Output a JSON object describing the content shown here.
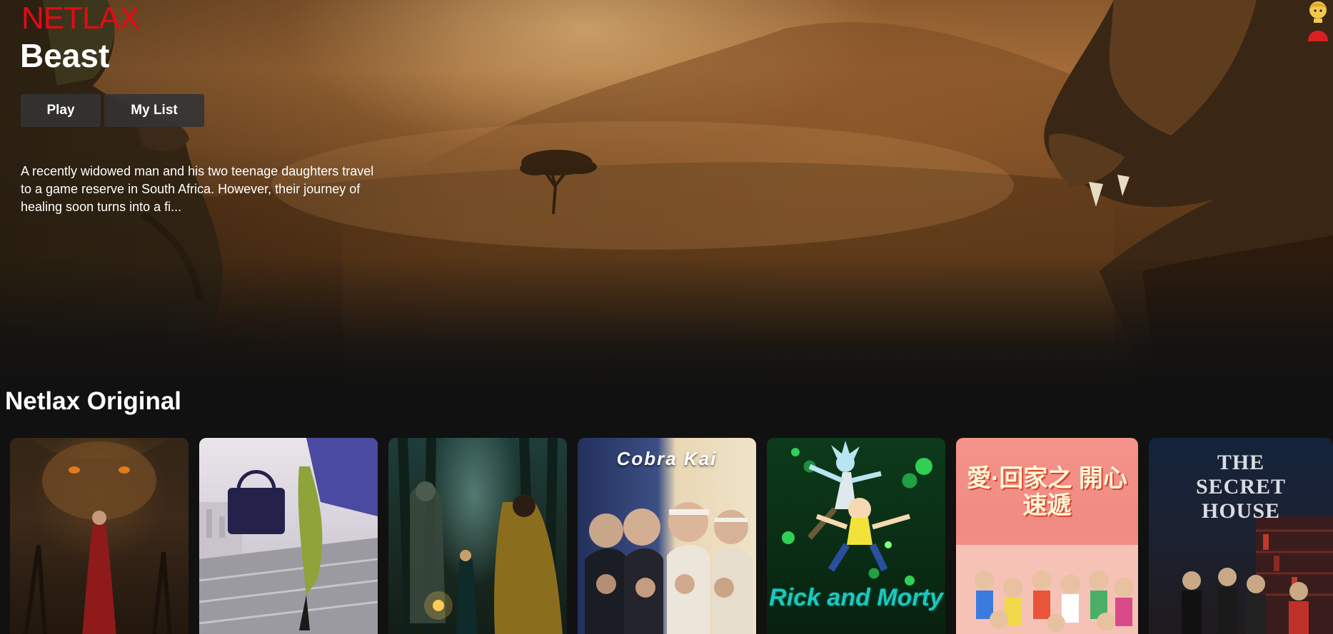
{
  "header": {
    "logo": "NETLAX",
    "profile_icon": "user-avatar-icon"
  },
  "hero": {
    "title": "Beast",
    "play_label": "Play",
    "mylist_label": "My List",
    "description": "A recently widowed man and his two teenage daughters travel to a game reserve in South Africa. However, their journey of healing soon turns into a fi..."
  },
  "row": {
    "title": "Netlax Original",
    "posters": [
      {
        "caption": "",
        "theme": "dragon"
      },
      {
        "caption": "",
        "theme": "hulk"
      },
      {
        "caption": "",
        "theme": "forest"
      },
      {
        "caption": "Cobra Kai",
        "theme": "cobra"
      },
      {
        "caption": "Rick and Morty",
        "theme": "rick"
      },
      {
        "caption": "愛·回家之 開心速遞",
        "theme": "happy"
      },
      {
        "caption": "THE SECRET HOUSE",
        "theme": "secret"
      }
    ]
  },
  "colors": {
    "brand": "#e50914",
    "background": "#111111",
    "button": "#333333"
  }
}
